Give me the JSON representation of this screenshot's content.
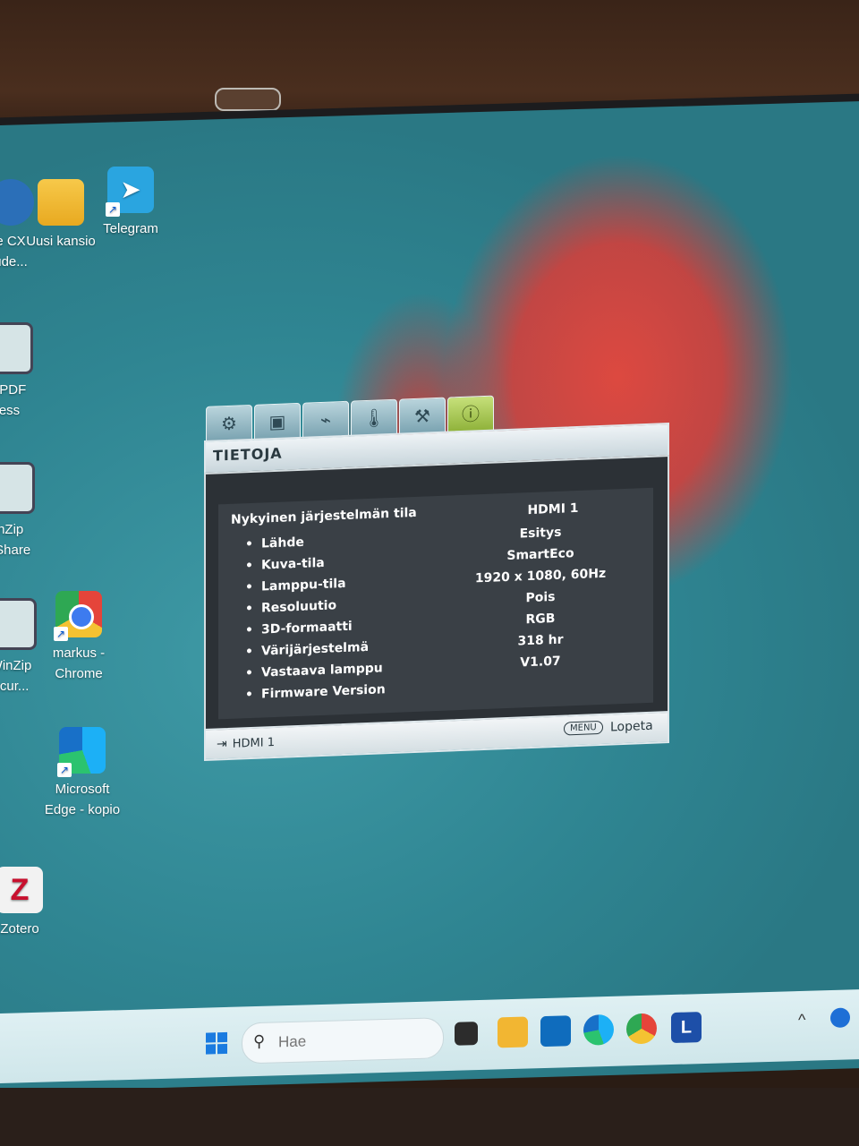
{
  "desktop": {
    "icons": [
      {
        "label": "e CX\nude...",
        "icon": "app-icon"
      },
      {
        "label": "Uusi kansio",
        "icon": "folder-icon"
      },
      {
        "label": "Telegram",
        "icon": "telegram-icon"
      },
      {
        "label": "o PDF\nress",
        "icon": "pdf-icon"
      },
      {
        "label": "inZip\neShare",
        "icon": "winzip-share-icon"
      },
      {
        "label": "WinZip\necur...",
        "icon": "winzip-secure-icon"
      },
      {
        "label": "markus -\nChrome",
        "icon": "chrome-icon"
      },
      {
        "label": "Microsoft\nEdge - kopio",
        "icon": "edge-icon"
      },
      {
        "label": "Zotero",
        "icon": "zotero-icon"
      }
    ]
  },
  "osd": {
    "title": "TIETOJA",
    "tabs": [
      "display-tab",
      "picture-tab",
      "source-tab",
      "system-tab",
      "advanced-tab",
      "info-tab"
    ],
    "active_tab": 5,
    "heading": "Nykyinen järjestelmän tila",
    "current_value": "HDMI 1",
    "rows": [
      {
        "label": "Lähde",
        "value": "Esitys"
      },
      {
        "label": "Kuva-tila",
        "value": "SmartEco"
      },
      {
        "label": "Lamppu-tila",
        "value": "1920 x 1080, 60Hz"
      },
      {
        "label": "Resoluutio",
        "value": "Pois"
      },
      {
        "label": "3D-formaatti",
        "value": "RGB"
      },
      {
        "label": "Värijärjestelmä",
        "value": "318 hr"
      },
      {
        "label": "Vastaava lamppu",
        "value": "V1.07"
      },
      {
        "label": "Firmware Version",
        "value": ""
      }
    ],
    "footer": {
      "source": "HDMI 1",
      "menu_button": "MENU",
      "exit": "Lopeta"
    }
  },
  "taskbar": {
    "search_placeholder": "Hae",
    "apps": [
      "task-view-icon",
      "file-explorer-icon",
      "outlook-icon",
      "edge-icon",
      "chrome-icon",
      "l-app-icon"
    ],
    "l_app_letter": "L"
  }
}
